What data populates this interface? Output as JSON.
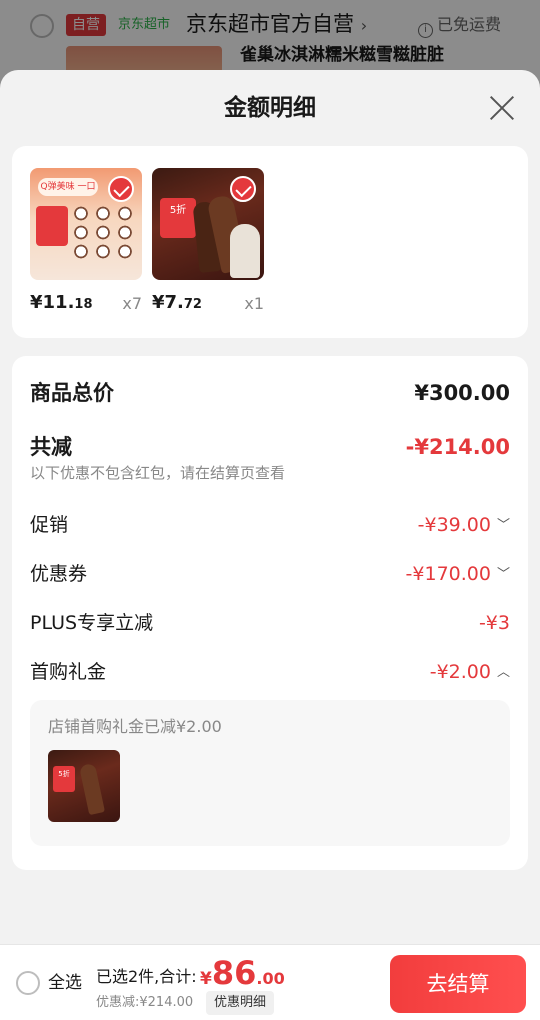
{
  "background": {
    "self_tag": "自营",
    "market_tag": "京东超市",
    "store_name": "京东超市官方自营",
    "store_arrow": "›",
    "shipping": "已免运费",
    "product_title": "雀巢冰淇淋糯米糍雪糍脏脏"
  },
  "sheet": {
    "title": "金额明细",
    "close_icon": "close-icon"
  },
  "products": [
    {
      "price_main": "¥11.",
      "price_dec": "18",
      "qty": "x7",
      "badge": "Q弹美味 一口"
    },
    {
      "price_main": "¥7.",
      "price_dec": "72",
      "qty": "x1",
      "promo": "5折"
    }
  ],
  "detail": {
    "total_label": "商品总价",
    "total_value": "¥300.00",
    "reduce_label": "共减",
    "reduce_value": "-¥214.00",
    "note": "以下优惠不包含红包，请在结算页查看",
    "items": [
      {
        "label": "促销",
        "value": "-¥39.00",
        "chevron": "﹀"
      },
      {
        "label": "优惠券",
        "value": "-¥170.00",
        "chevron": "﹀"
      },
      {
        "label": "PLUS专享立减",
        "value": "-¥3",
        "chevron": ""
      },
      {
        "label": "首购礼金",
        "value": "-¥2.00",
        "chevron": "︿"
      }
    ],
    "sub_text": "店铺首购礼金已减¥2.00"
  },
  "bottom": {
    "select_all": "全选",
    "count_text": "已选2件,合计:",
    "currency": "¥",
    "total_int": "86",
    "total_dec": ".00",
    "saved": "优惠减:¥214.00",
    "detail_button": "优惠明细",
    "checkout_button": "去结算"
  },
  "colors": {
    "accent": "#e4393c",
    "green_tag": "#2cb34a"
  }
}
